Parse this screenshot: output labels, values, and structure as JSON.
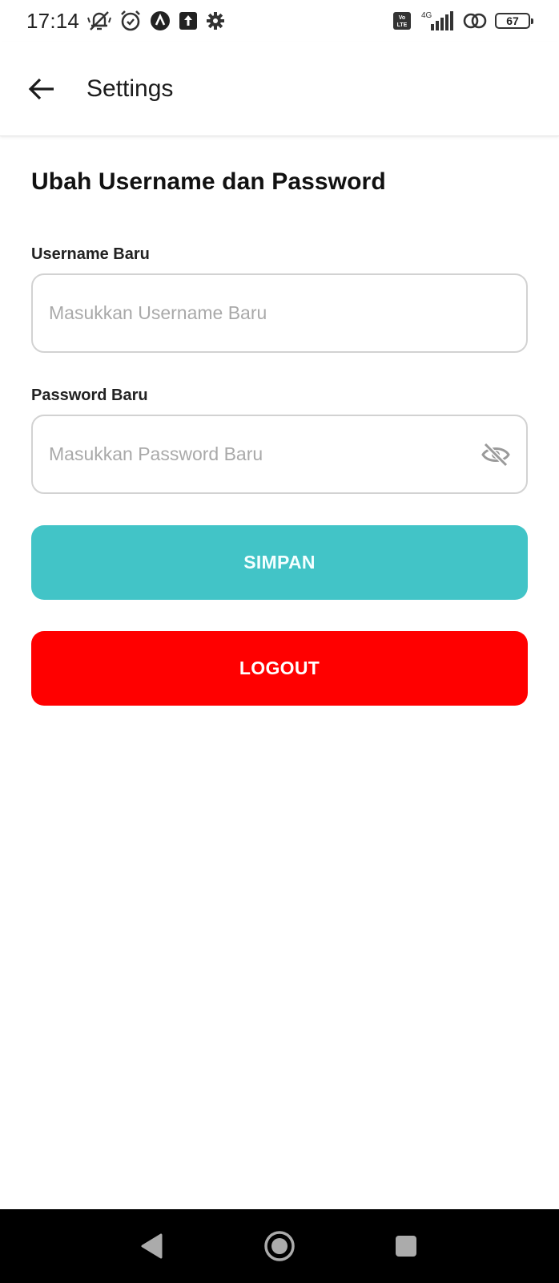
{
  "status_bar": {
    "time": "17:14",
    "left_icons": [
      "mute-icon",
      "alarm-icon",
      "navigation-app-icon",
      "upload-icon",
      "settings-gear-icon"
    ],
    "right_icons": [
      "volte-icon",
      "signal-4g-icon",
      "hotspot-icon",
      "battery-icon"
    ],
    "network_type": "4G",
    "volte_label": "Vo LTE",
    "battery_level": "67"
  },
  "app_bar": {
    "title": "Settings",
    "back_icon": "arrow-left-icon"
  },
  "form": {
    "section_title": "Ubah Username dan Password",
    "username": {
      "label": "Username Baru",
      "placeholder": "Masukkan Username Baru",
      "value": ""
    },
    "password": {
      "label": "Password Baru",
      "placeholder": "Masukkan Password Baru",
      "value": "",
      "toggle_icon": "eye-off-icon"
    },
    "save_label": "SIMPAN",
    "logout_label": "LOGOUT"
  },
  "colors": {
    "save_button": "#42c4c7",
    "logout_button": "#ff0000",
    "input_border": "#d2d2d2",
    "placeholder": "#a9a9a9",
    "nav_bar": "#000000"
  },
  "nav_bar": {
    "icons": [
      "nav-back-icon",
      "nav-home-icon",
      "nav-recents-icon"
    ]
  }
}
